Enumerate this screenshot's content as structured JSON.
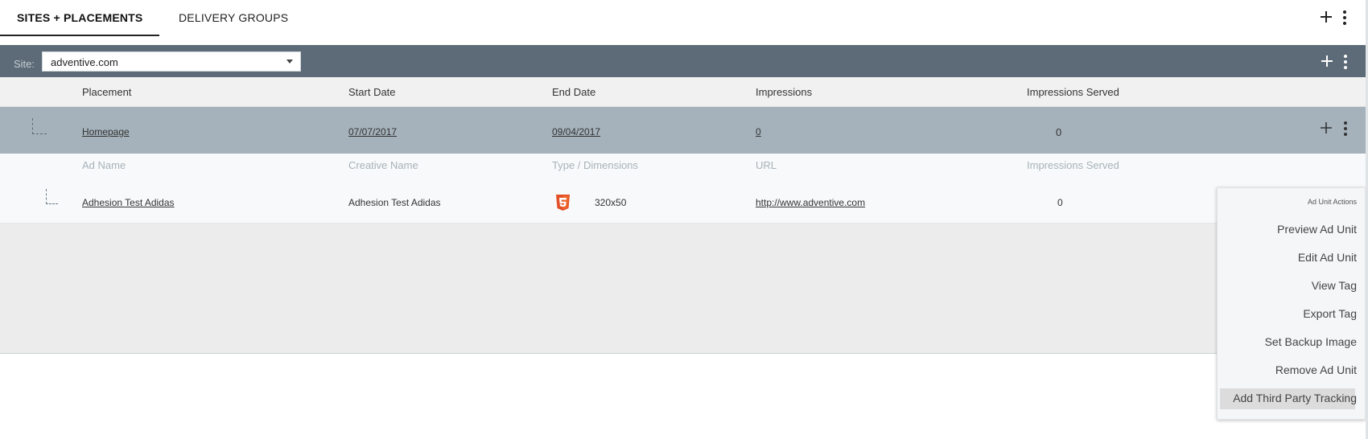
{
  "tabs": {
    "items": [
      {
        "label": "SITES + PLACEMENTS",
        "active": true
      },
      {
        "label": "DELIVERY GROUPS",
        "active": false
      }
    ],
    "icons": {
      "add": "plus-icon",
      "more": "kebab-icon"
    }
  },
  "site_bar": {
    "label": "Site:",
    "selected": "adventive.com",
    "icons": {
      "add": "plus-icon",
      "more": "kebab-icon"
    }
  },
  "placements_table": {
    "columns": [
      "Placement",
      "Start Date",
      "End Date",
      "Impressions",
      "Impressions Served"
    ],
    "rows": [
      {
        "placement": "Homepage",
        "start_date": "07/07/2017",
        "end_date": "09/04/2017",
        "impressions": "0",
        "impressions_served": "0"
      }
    ]
  },
  "ads_table": {
    "columns": [
      "Ad Name",
      "Creative Name",
      "Type / Dimensions",
      "URL",
      "Impressions Served"
    ],
    "rows": [
      {
        "ad_name": "Adhesion Test Adidas",
        "creative_name": "Adhesion Test Adidas",
        "type_icon": "html5-icon",
        "dimensions": "320x50",
        "url": "http://www.adventive.com",
        "impressions_served": "0"
      }
    ]
  },
  "context_menu": {
    "title": "Ad Unit Actions",
    "items": [
      "Preview Ad Unit",
      "Edit Ad Unit",
      "View Tag",
      "Export Tag",
      "Set Backup Image",
      "Remove Ad Unit",
      "Add Third Party Tracking"
    ],
    "highlighted": "Add Third Party Tracking"
  },
  "colors": {
    "site_bar_bg": "#5c6b77",
    "placement_row_bg": "#a5b2bb",
    "html5_orange": "#e34f26"
  }
}
